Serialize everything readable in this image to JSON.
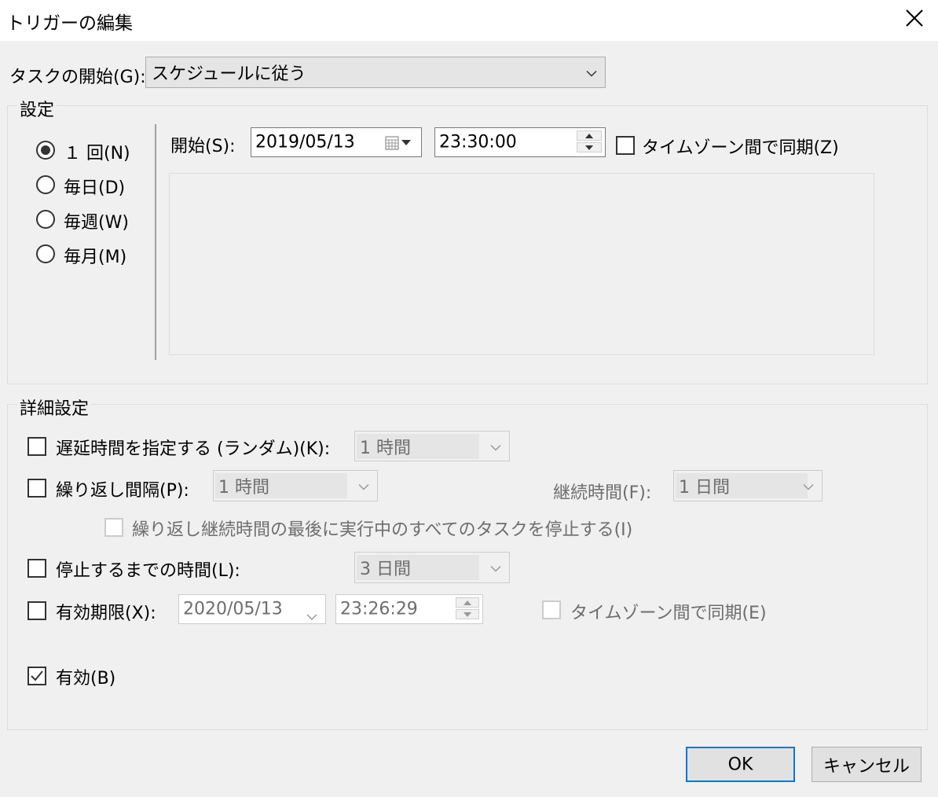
{
  "window": {
    "title": "トリガーの編集"
  },
  "begin_task": {
    "label": "タスクの開始(G):",
    "value": "スケジュールに従う"
  },
  "settings": {
    "group_label": "設定",
    "schedule_options": [
      {
        "label": "１ 回(N)",
        "selected": true
      },
      {
        "label": "毎日(D)",
        "selected": false
      },
      {
        "label": "毎週(W)",
        "selected": false
      },
      {
        "label": "毎月(M)",
        "selected": false
      }
    ],
    "start_label": "開始(S):",
    "start_date": "2019/05/13",
    "start_time": "23:30:00",
    "sync_timezone_label": "タイムゾーン間で同期(Z)",
    "sync_timezone_checked": false
  },
  "advanced": {
    "group_label": "詳細設定",
    "delay": {
      "label": "遅延時間を指定する (ランダム)(K):",
      "value": "1 時間",
      "checked": false
    },
    "repeat": {
      "label": "繰り返し間隔(P):",
      "value": "1 時間",
      "checked": false,
      "duration_label": "継続時間(F):",
      "duration_value": "1 日間",
      "stop_all_label": "繰り返し継続時間の最後に実行中のすべてのタスクを停止する(I)"
    },
    "stop_after": {
      "label": "停止するまでの時間(L):",
      "value": "3 日間",
      "checked": false
    },
    "expire": {
      "label": "有効期限(X):",
      "date": "2020/05/13",
      "time": "23:26:29",
      "checked": false,
      "sync_timezone_label": "タイムゾーン間で同期(E)"
    },
    "enabled": {
      "label": "有効(B)",
      "checked": true
    }
  },
  "buttons": {
    "ok": "OK",
    "cancel": "キャンセル"
  },
  "colors": {
    "accent": "#0078d7",
    "window_bg": "#f0f0f0"
  }
}
